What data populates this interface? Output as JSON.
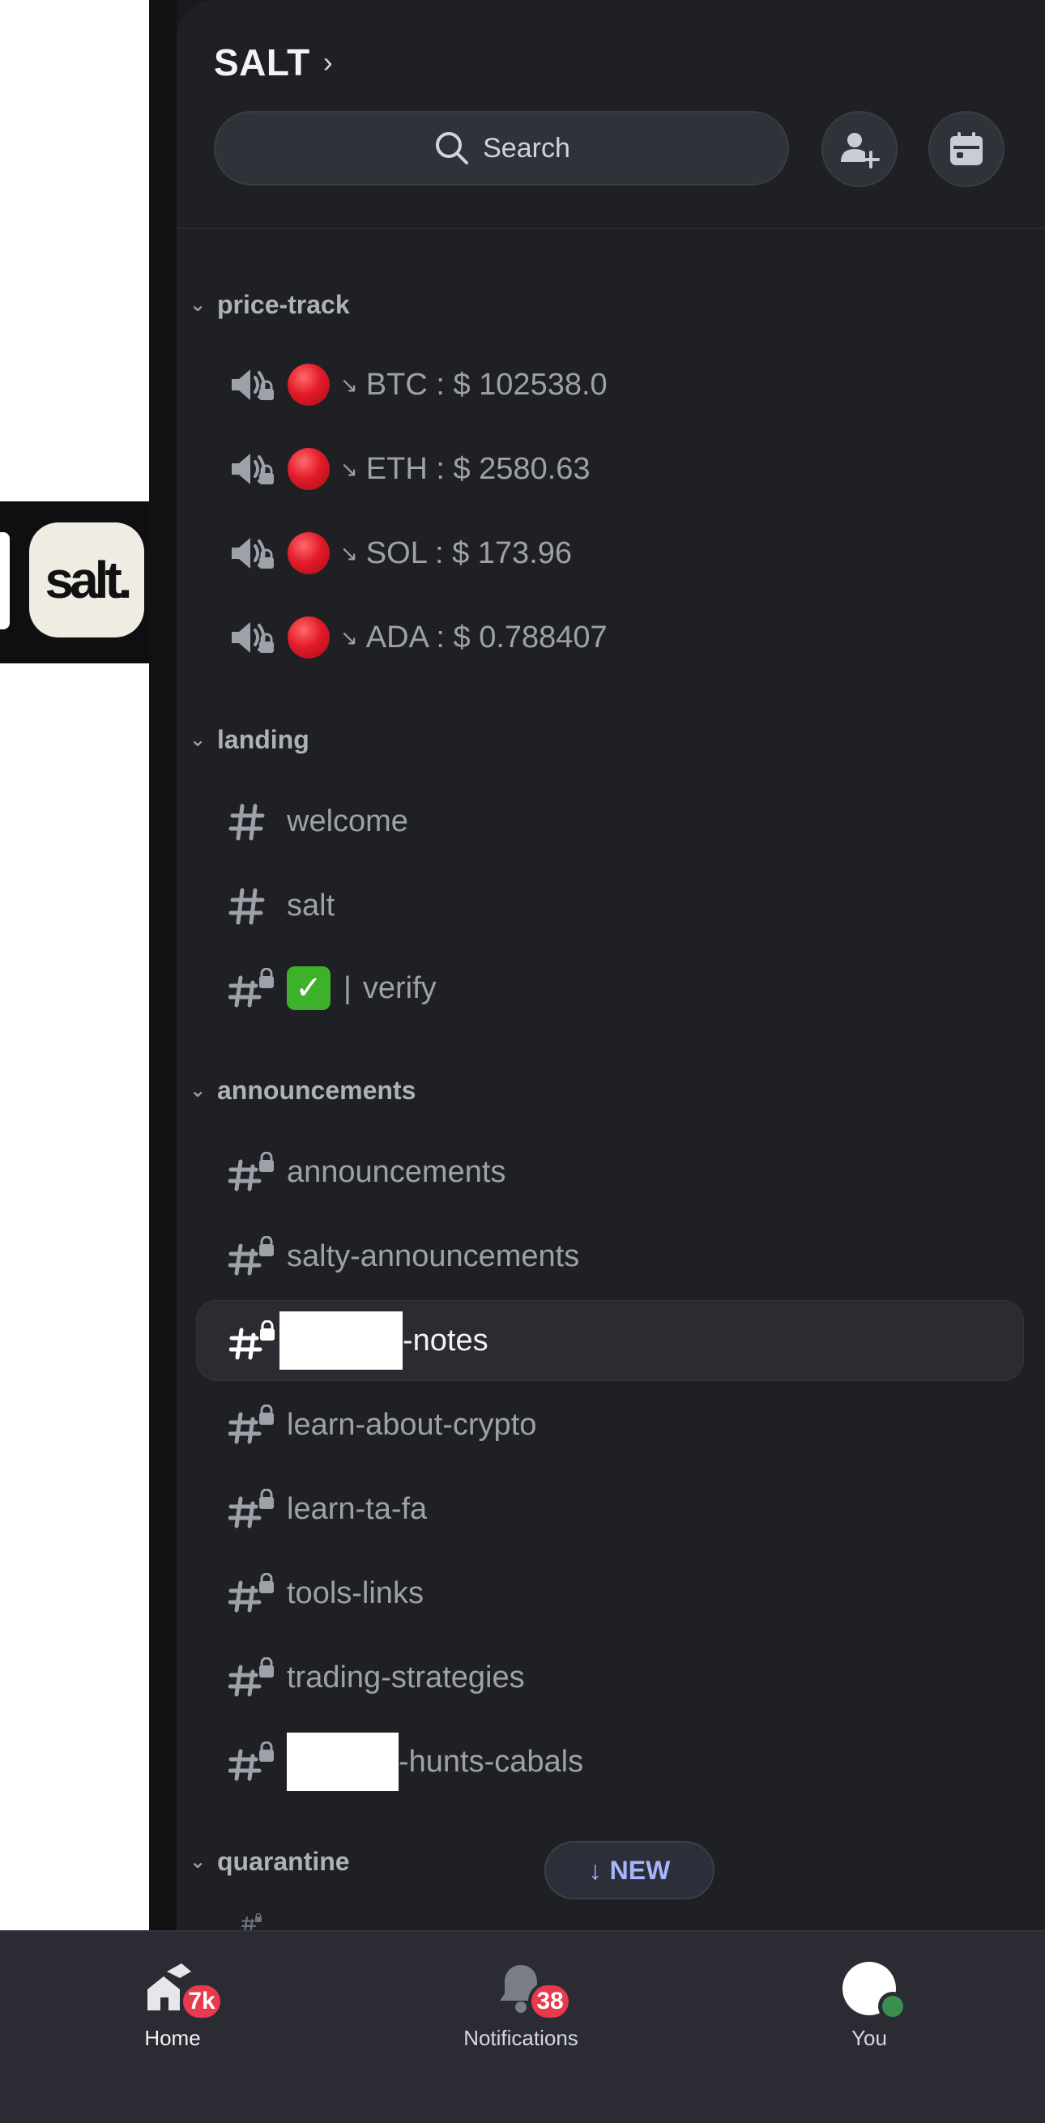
{
  "server": {
    "name": "SALT",
    "icon_text": "salt."
  },
  "search": {
    "label": "Search"
  },
  "categories": [
    {
      "name": "price-track"
    },
    {
      "name": "landing"
    },
    {
      "name": "announcements"
    },
    {
      "name": "quarantine"
    }
  ],
  "price_channels": [
    {
      "label": "BTC : $ 102538.0"
    },
    {
      "label": "ETH : $ 2580.63"
    },
    {
      "label": "SOL : $ 173.96"
    },
    {
      "label": "ADA : $ 0.788407"
    }
  ],
  "landing_channels": [
    {
      "label": "welcome"
    },
    {
      "label": "salt"
    },
    {
      "label": "verify"
    }
  ],
  "announcement_channels": [
    {
      "label": "announcements"
    },
    {
      "label": "salty-announcements"
    },
    {
      "label": "-notes"
    },
    {
      "label": "learn-about-crypto"
    },
    {
      "label": "learn-ta-fa"
    },
    {
      "label": "tools-links"
    },
    {
      "label": "trading-strategies"
    },
    {
      "label": "-hunts-cabals"
    }
  ],
  "new_pill": {
    "label": "NEW"
  },
  "nav": {
    "home": {
      "label": "Home",
      "badge": "7k"
    },
    "notifications": {
      "label": "Notifications",
      "badge": "38"
    },
    "you": {
      "label": "You"
    }
  },
  "colors": {
    "panel": "#1f2024",
    "active_row": "#2b2c32",
    "badge": "#e8394d",
    "new_text": "#a9b4ff",
    "status_online": "#3b8f4e"
  },
  "icons": [
    "search-icon",
    "add-member-icon",
    "calendar-icon",
    "speaker-lock-icon",
    "hash-icon",
    "hash-lock-icon",
    "red-circle-emoji",
    "check-mark-emoji",
    "home-icon",
    "bell-icon"
  ]
}
